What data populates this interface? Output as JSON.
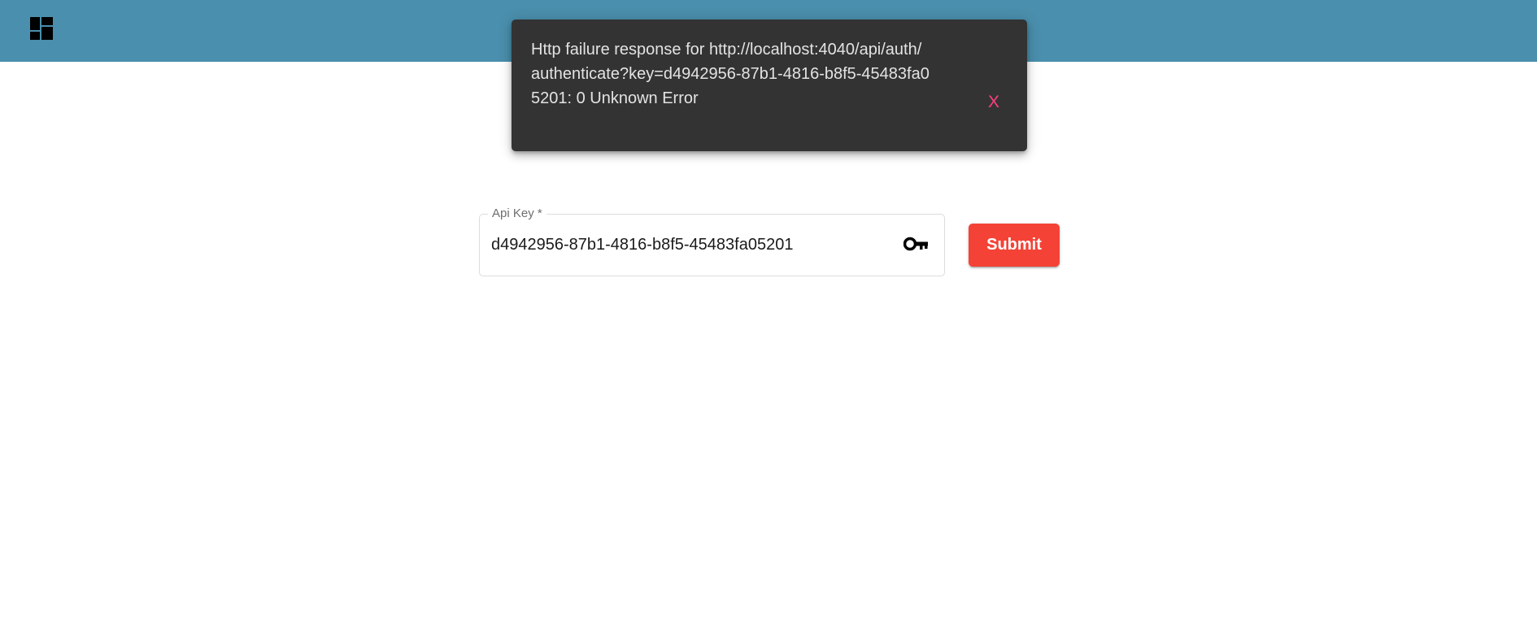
{
  "toolbar": {
    "icon": "dashboard-icon",
    "background_color": "#4a8fad"
  },
  "snackbar": {
    "message": "Http failure response for http://localhost:4040/api/auth/authenticate?key=d4942956-87b1-4816-b8f5-45483fa05201: 0 Unknown Error",
    "action_label": "X",
    "background_color": "#333333",
    "action_color": "#ff4081"
  },
  "login_form": {
    "api_key_label": "Api Key *",
    "api_key_value": "d4942956-87b1-4816-b8f5-45483fa05201",
    "field_icon": "key-icon",
    "submit_label": "Submit",
    "submit_color": "#f44336"
  }
}
